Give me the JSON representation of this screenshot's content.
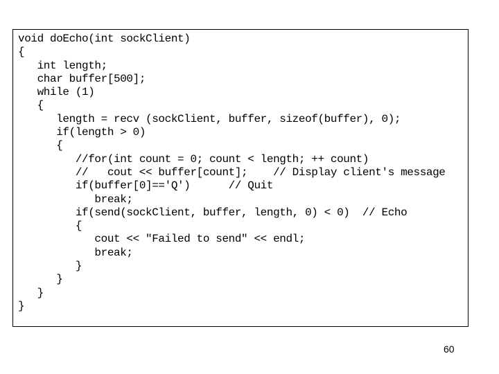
{
  "slide": {
    "code_lines": [
      "void doEcho(int sockClient)",
      "{",
      "   int length;",
      "   char buffer[500];",
      "   while (1)",
      "   {",
      "      length = recv (sockClient, buffer, sizeof(buffer), 0);",
      "      if(length > 0)",
      "      {",
      "         //for(int count = 0; count < length; ++ count)",
      "         //   cout << buffer[count];    // Display client's message",
      "         if(buffer[0]=='Q')      // Quit",
      "            break;",
      "         if(send(sockClient, buffer, length, 0) < 0)  // Echo",
      "         {",
      "            cout << \"Failed to send\" << endl;",
      "            break;",
      "         }",
      "      }",
      "   }",
      "}"
    ],
    "page_number": "60"
  }
}
